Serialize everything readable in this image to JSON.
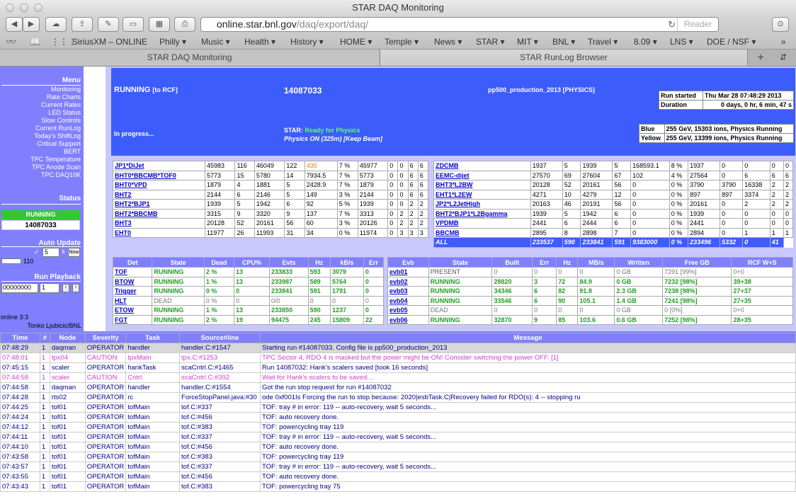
{
  "window": {
    "title": "STAR DAQ Monitoring"
  },
  "toolbar": {
    "url_host": "online.star.bnl.gov",
    "url_path": "/daq/export/daq/",
    "reader": "Reader"
  },
  "bookmarks": [
    "SiriusXM – ONLINE",
    "Philly ▾",
    "Music ▾",
    "Health ▾",
    "History ▾",
    "HOME ▾",
    "Temple ▾",
    "News ▾",
    "STAR ▾",
    "MIT ▾",
    "BNL ▾",
    "Travel ▾",
    "8.09 ▾",
    "LNS ▾",
    "DOE / NSF ▾"
  ],
  "tabs": [
    "STAR DAQ Monitoring",
    "STAR RunLog Browser"
  ],
  "sidebar": {
    "menu_title": "Menu",
    "items": [
      "Monitoring",
      "Rate Charts",
      "Current Rates",
      "LED Status",
      "Slow Controls",
      "Current RunLog",
      "Today's ShiftLog",
      "Critical Support",
      "BERT",
      "TPC Temperature",
      "TPC Anode Scan",
      "TPC DAQ10K"
    ],
    "status_title": "Status",
    "status": "RUNNING",
    "run_number": "14087033",
    "auto_update_title": "Auto Update",
    "auto_value": "5",
    "auto_unit": "s",
    "now_label": "Now",
    "progress_value": "110",
    "playback_title": "Run Playback",
    "playback_start": "00000000",
    "playback_step": "1",
    "online": "online 3:3",
    "user": "Tonko Ljubicic/BNL"
  },
  "banner": {
    "state": "RUNNING",
    "state_sub": "[to RCF]",
    "run": "14087033",
    "config": "pp500_production_2013  [PHYSICS]",
    "progress": "In progress...",
    "star_label": "STAR:",
    "star_status": "Ready for Physics",
    "physics": "Physics ON (325m) [Keep Beam]",
    "run_started_label": "Run started",
    "run_started": "Thu Mar 28 07:48:29 2013",
    "duration_label": "Duration",
    "duration": "0 days, 0 hr, 6 min, 47 s",
    "blue_label": "Blue",
    "blue": "255 GeV, 15303 ions, Physics Running",
    "yellow_label": "Yellow",
    "yellow": "255 GeV, 13399 ions, Physics Running"
  },
  "triggers_left": [
    [
      "JP1*DiJet",
      "45983",
      "116",
      "46049",
      "122",
      "435",
      "7 %",
      "45977",
      "0",
      "0",
      "6",
      "6"
    ],
    [
      "BHT0*BBCMB*TOF0",
      "5773",
      "15",
      "5780",
      "14",
      "7934.5",
      "7 %",
      "5773",
      "0",
      "0",
      "6",
      "6"
    ],
    [
      "BHT0*VPD",
      "1879",
      "4",
      "1881",
      "5",
      "2428.9",
      "7 %",
      "1879",
      "0",
      "0",
      "6",
      "6"
    ],
    [
      "BHT2",
      "2144",
      "6",
      "2146",
      "5",
      "149",
      "3 %",
      "2144",
      "0",
      "0",
      "6",
      "6"
    ],
    [
      "BHT2*BJP1",
      "1939",
      "5",
      "1942",
      "6",
      "92",
      "5 %",
      "1939",
      "0",
      "0",
      "2",
      "2"
    ],
    [
      "BHT2*BBCMB",
      "3315",
      "9",
      "3320",
      "9",
      "137",
      "7 %",
      "3313",
      "0",
      "2",
      "2",
      "2"
    ],
    [
      "BHT3",
      "20128",
      "52",
      "20161",
      "56",
      "60",
      "3 %",
      "20126",
      "0",
      "2",
      "2",
      "2"
    ],
    [
      "EHT0",
      "11977",
      "26",
      "11993",
      "31",
      "34",
      "0 %",
      "11974",
      "0",
      "3",
      "3",
      "3"
    ]
  ],
  "triggers_right": [
    [
      "ZDCMB",
      "1937",
      "5",
      "1939",
      "5",
      "168593.1",
      "8 %",
      "1937",
      "0",
      "0",
      "0",
      "0"
    ],
    [
      "EEMC-dijet",
      "27570",
      "69",
      "27604",
      "67",
      "102",
      "4 %",
      "27564",
      "0",
      "6",
      "6",
      "6"
    ],
    [
      "BHT3*L2BW",
      "20128",
      "52",
      "20161",
      "56",
      "0",
      "0 %",
      "3790",
      "3790",
      "16338",
      "2",
      "2"
    ],
    [
      "EHT1*L2EW",
      "4271",
      "10",
      "4279",
      "12",
      "0",
      "0 %",
      "897",
      "897",
      "3374",
      "2",
      "2"
    ],
    [
      "JP2*L2JetHigh",
      "20163",
      "46",
      "20191",
      "56",
      "0",
      "0 %",
      "20161",
      "0",
      "2",
      "2",
      "2"
    ],
    [
      "BHT2*BJP1*L2Bgamma",
      "1939",
      "5",
      "1942",
      "6",
      "0",
      "0 %",
      "1939",
      "0",
      "0",
      "0",
      "0"
    ],
    [
      "VPDMB",
      "2441",
      "6",
      "2444",
      "6",
      "0",
      "0 %",
      "2441",
      "0",
      "0",
      "0",
      "0"
    ],
    [
      "BBCMB",
      "2895",
      "8",
      "2898",
      "7",
      "0",
      "0 %",
      "2894",
      "0",
      "1",
      "1",
      "1"
    ]
  ],
  "trigger_all": [
    "ALL",
    "233537",
    "590",
    "233841",
    "591",
    "9383000",
    "0 %",
    "233496",
    "5332",
    "0",
    "41"
  ],
  "det_headers": [
    "Det",
    "State",
    "Dead",
    "CPU%",
    "Evts",
    "Hz",
    "kB/s",
    "Err"
  ],
  "det_rows": [
    [
      "TOF",
      "RUNNING",
      "2 %",
      "13",
      "233833",
      "593",
      "3079",
      "0"
    ],
    [
      "BTOW",
      "RUNNING",
      "1 %",
      "13",
      "233987",
      "589",
      "5764",
      "0"
    ],
    [
      "Trigger",
      "RUNNING",
      "0 %",
      "0",
      "233841",
      "591",
      "1791",
      "0"
    ],
    [
      "HLT",
      "DEAD",
      "0 %",
      "0",
      "0/0",
      "0",
      "0",
      "0"
    ],
    [
      "ETOW",
      "RUNNING",
      "1 %",
      "13",
      "233850",
      "590",
      "1237",
      "0"
    ],
    [
      "FGT",
      "RUNNING",
      "2 %",
      "19",
      "94475",
      "245",
      "15809",
      "22"
    ]
  ],
  "evb_headers": [
    "Evb",
    "State",
    "Built",
    "Err",
    "Hz",
    "MB/s",
    "Written",
    "Free GB",
    "RCF W+S"
  ],
  "evb_rows": [
    [
      "evb01",
      "PRESENT",
      "0",
      "0",
      "0",
      "0",
      "0 GB",
      "7291 [99%]",
      "0+0"
    ],
    [
      "evb02",
      "RUNNING",
      "28820",
      "3",
      "72",
      "84.9",
      "0 GB",
      "7232 [98%]",
      "39+38"
    ],
    [
      "evb03",
      "RUNNING",
      "34346",
      "6",
      "82",
      "91.8",
      "2.3 GB",
      "7238 [98%]",
      "27+37"
    ],
    [
      "evb04",
      "RUNNING",
      "33546",
      "6",
      "90",
      "105.1",
      "1.4 GB",
      "7241 [98%]",
      "27+35"
    ],
    [
      "evb05",
      "DEAD",
      "0",
      "0",
      "0",
      "0",
      "0 GB",
      "0 [0%]",
      "0+0"
    ],
    [
      "evb06",
      "RUNNING",
      "32870",
      "9",
      "85",
      "103.6",
      "0.6 GB",
      "7252 [98%]",
      "28+35"
    ]
  ],
  "log_headers": [
    "Time",
    "#",
    "Node",
    "Severity",
    "Task",
    "Source#line",
    "Message"
  ],
  "log_rows": [
    {
      "cls": "hl",
      "cells": [
        "07:48:29",
        "1",
        "daqman",
        "OPERATOR",
        "handler",
        "handler.C:#1547",
        "Starting run #14087033. Config file is pp500_production_2013"
      ]
    },
    {
      "cls": "caution",
      "cells": [
        "07:48:01",
        "1",
        "tpx04",
        "CAUTION",
        "tpxMain",
        "tpx.C:#1253",
        "TPC Sector 4, RDO 4 is masked but the power might be ON! Consider switching the power OFF. [1]"
      ]
    },
    {
      "cls": "",
      "cells": [
        "07:45:15",
        "1",
        "scaler",
        "OPERATOR",
        "hankTask",
        "scaCntrl.C:#1465",
        "Run 14087032: Hank's scalers saved [took 16 seconds]"
      ]
    },
    {
      "cls": "caution",
      "cells": [
        "07:44:58",
        "1",
        "scaler",
        "CAUTION",
        "Cntrl",
        "scaCntrl.C:#392",
        "Wait for Hank's scalers to be saved...."
      ]
    },
    {
      "cls": "",
      "cells": [
        "07:44:58",
        "1",
        "daqman",
        "OPERATOR",
        "handler",
        "handler.C:#1554",
        "Got the run stop request for run #14087032"
      ]
    },
    {
      "cls": "",
      "cells": [
        "07:44:28",
        "1",
        "rts02",
        "OPERATOR",
        "rc",
        "ForceStopPanel.java:#30",
        "ode 0xf001Is Forcing the run to stop because: 2020|esbTask.C|Recovery failed for RDO(s): 4 -- stopping ru"
      ]
    },
    {
      "cls": "",
      "cells": [
        "07:44:25",
        "1",
        "tof01",
        "OPERATOR",
        "tofMain",
        "tof.C:#337",
        "TOF: tray # in error: 119 -- auto-recovery, wait 5 seconds..."
      ]
    },
    {
      "cls": "",
      "cells": [
        "07:44:24",
        "1",
        "tof01",
        "OPERATOR",
        "tofMain",
        "tof.C:#456",
        "TOF: auto recovery done."
      ]
    },
    {
      "cls": "",
      "cells": [
        "07:44:12",
        "1",
        "tof01",
        "OPERATOR",
        "tofMain",
        "tof.C:#383",
        "TOF: powercycling tray 119"
      ]
    },
    {
      "cls": "",
      "cells": [
        "07:44:11",
        "1",
        "tof01",
        "OPERATOR",
        "tofMain",
        "tof.C:#337",
        "TOF: tray # in error: 119 -- auto-recovery, wait 5 seconds..."
      ]
    },
    {
      "cls": "",
      "cells": [
        "07:44:10",
        "1",
        "tof01",
        "OPERATOR",
        "tofMain",
        "tof.C:#456",
        "TOF: auto recovery done."
      ]
    },
    {
      "cls": "",
      "cells": [
        "07:43:58",
        "1",
        "tof01",
        "OPERATOR",
        "tofMain",
        "tof.C:#383",
        "TOF: powercycling tray 119"
      ]
    },
    {
      "cls": "",
      "cells": [
        "07:43:57",
        "1",
        "tof01",
        "OPERATOR",
        "tofMain",
        "tof.C:#337",
        "TOF: tray # in error: 119 -- auto-recovery, wait 5 seconds..."
      ]
    },
    {
      "cls": "",
      "cells": [
        "07:43:55",
        "1",
        "tof01",
        "OPERATOR",
        "tofMain",
        "tof.C:#456",
        "TOF: auto recovery done."
      ]
    },
    {
      "cls": "",
      "cells": [
        "07:43:43",
        "1",
        "tof01",
        "OPERATOR",
        "tofMain",
        "tof.C:#383",
        "TOF: powercycling tray 75"
      ]
    }
  ],
  "colors": {
    "accent": "#3c5cfb",
    "sidebar": "#8080ff",
    "running": "#31c831",
    "caution": "#d040d0"
  }
}
